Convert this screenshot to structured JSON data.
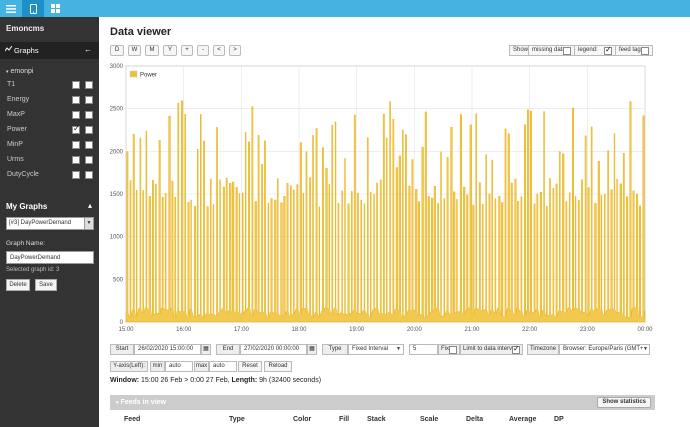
{
  "topbar": {
    "icons": [
      "menu-icon",
      "tablet-icon",
      "dashboard-grid-icon"
    ],
    "color": "#44b3e2"
  },
  "sidebar": {
    "app_name": "Emoncms",
    "graphs_label": "Graphs",
    "node": "emonpi",
    "feeds": [
      {
        "name": "T1",
        "left": false,
        "right": false
      },
      {
        "name": "Energy",
        "left": false,
        "right": false
      },
      {
        "name": "MaxP",
        "left": false,
        "right": false
      },
      {
        "name": "Power",
        "left": true,
        "right": false
      },
      {
        "name": "MinP",
        "left": false,
        "right": false
      },
      {
        "name": "Urms",
        "left": false,
        "right": false
      },
      {
        "name": "DutyCycle",
        "left": false,
        "right": false
      }
    ],
    "my_graphs_label": "My Graphs",
    "graph_select": "[#3] DayPowerDemand",
    "graph_name_label": "Graph Name:",
    "graph_name_value": "DayPowerDemand",
    "selected_graph": "Selected graph id: 3",
    "delete_label": "Delete",
    "save_label": "Save"
  },
  "main": {
    "title": "Data viewer",
    "nav_buttons": [
      "D",
      "W",
      "M",
      "Y",
      "+",
      "-",
      "<",
      ">"
    ],
    "show_label": "Show",
    "missing_data_label": "missing data:",
    "missing_data_checked": false,
    "legend_label": "legend:",
    "legend_checked": true,
    "feed_tag_label": "feed tag:",
    "feed_tag_checked": false
  },
  "controls": {
    "start_label": "Start",
    "start_value": "26/02/2020 15:00:00",
    "end_label": "End",
    "end_value": "27/02/2020 00:00:00",
    "type_label": "Type",
    "type_value": "Fixed Interval",
    "interval_value": "5",
    "fix_label": "Fix",
    "limit_label": "Limit to data interval",
    "limit_checked": true,
    "timezone_label": "Timezone",
    "timezone_value": "Browser: Europe/Paris (GMT+",
    "yaxis_label": "Y-axis(Left):",
    "min_label": "min",
    "min_value": "auto",
    "max_label": "max",
    "max_value": "auto",
    "reset_label": "Reset",
    "reload_label": "Reload"
  },
  "window_info": {
    "prefix": "Window:",
    "range": " 15:00 26 Feb > 0:00 27 Feb, ",
    "length_label": "Length:",
    "length_value": " 9h (32400 seconds)"
  },
  "feeds_panel": {
    "title": "Feeds in view",
    "show_stats_label": "Show statistics",
    "columns": [
      "Feed",
      "Type",
      "Color",
      "Fill",
      "Stack",
      "Scale",
      "Delta",
      "Average",
      "DP"
    ]
  },
  "chart_data": {
    "type": "area",
    "legend": [
      "Power"
    ],
    "legend_position": "top-left",
    "color": "#f0c030",
    "grid": true,
    "x_range": [
      "15:00",
      "00:00"
    ],
    "x_ticks": [
      "15:00",
      "16:00",
      "17:00",
      "18:00",
      "19:00",
      "20:00",
      "21:00",
      "22:00",
      "23:00",
      "00:00"
    ],
    "ylim": [
      0,
      3000
    ],
    "y_ticks": [
      0,
      500,
      1000,
      1500,
      2000,
      2500,
      3000
    ],
    "series": [
      {
        "name": "Power",
        "baseline_low": 50,
        "typical_high": 1500,
        "peak_max": 2600,
        "cycles_per_hour": 18
      }
    ]
  }
}
